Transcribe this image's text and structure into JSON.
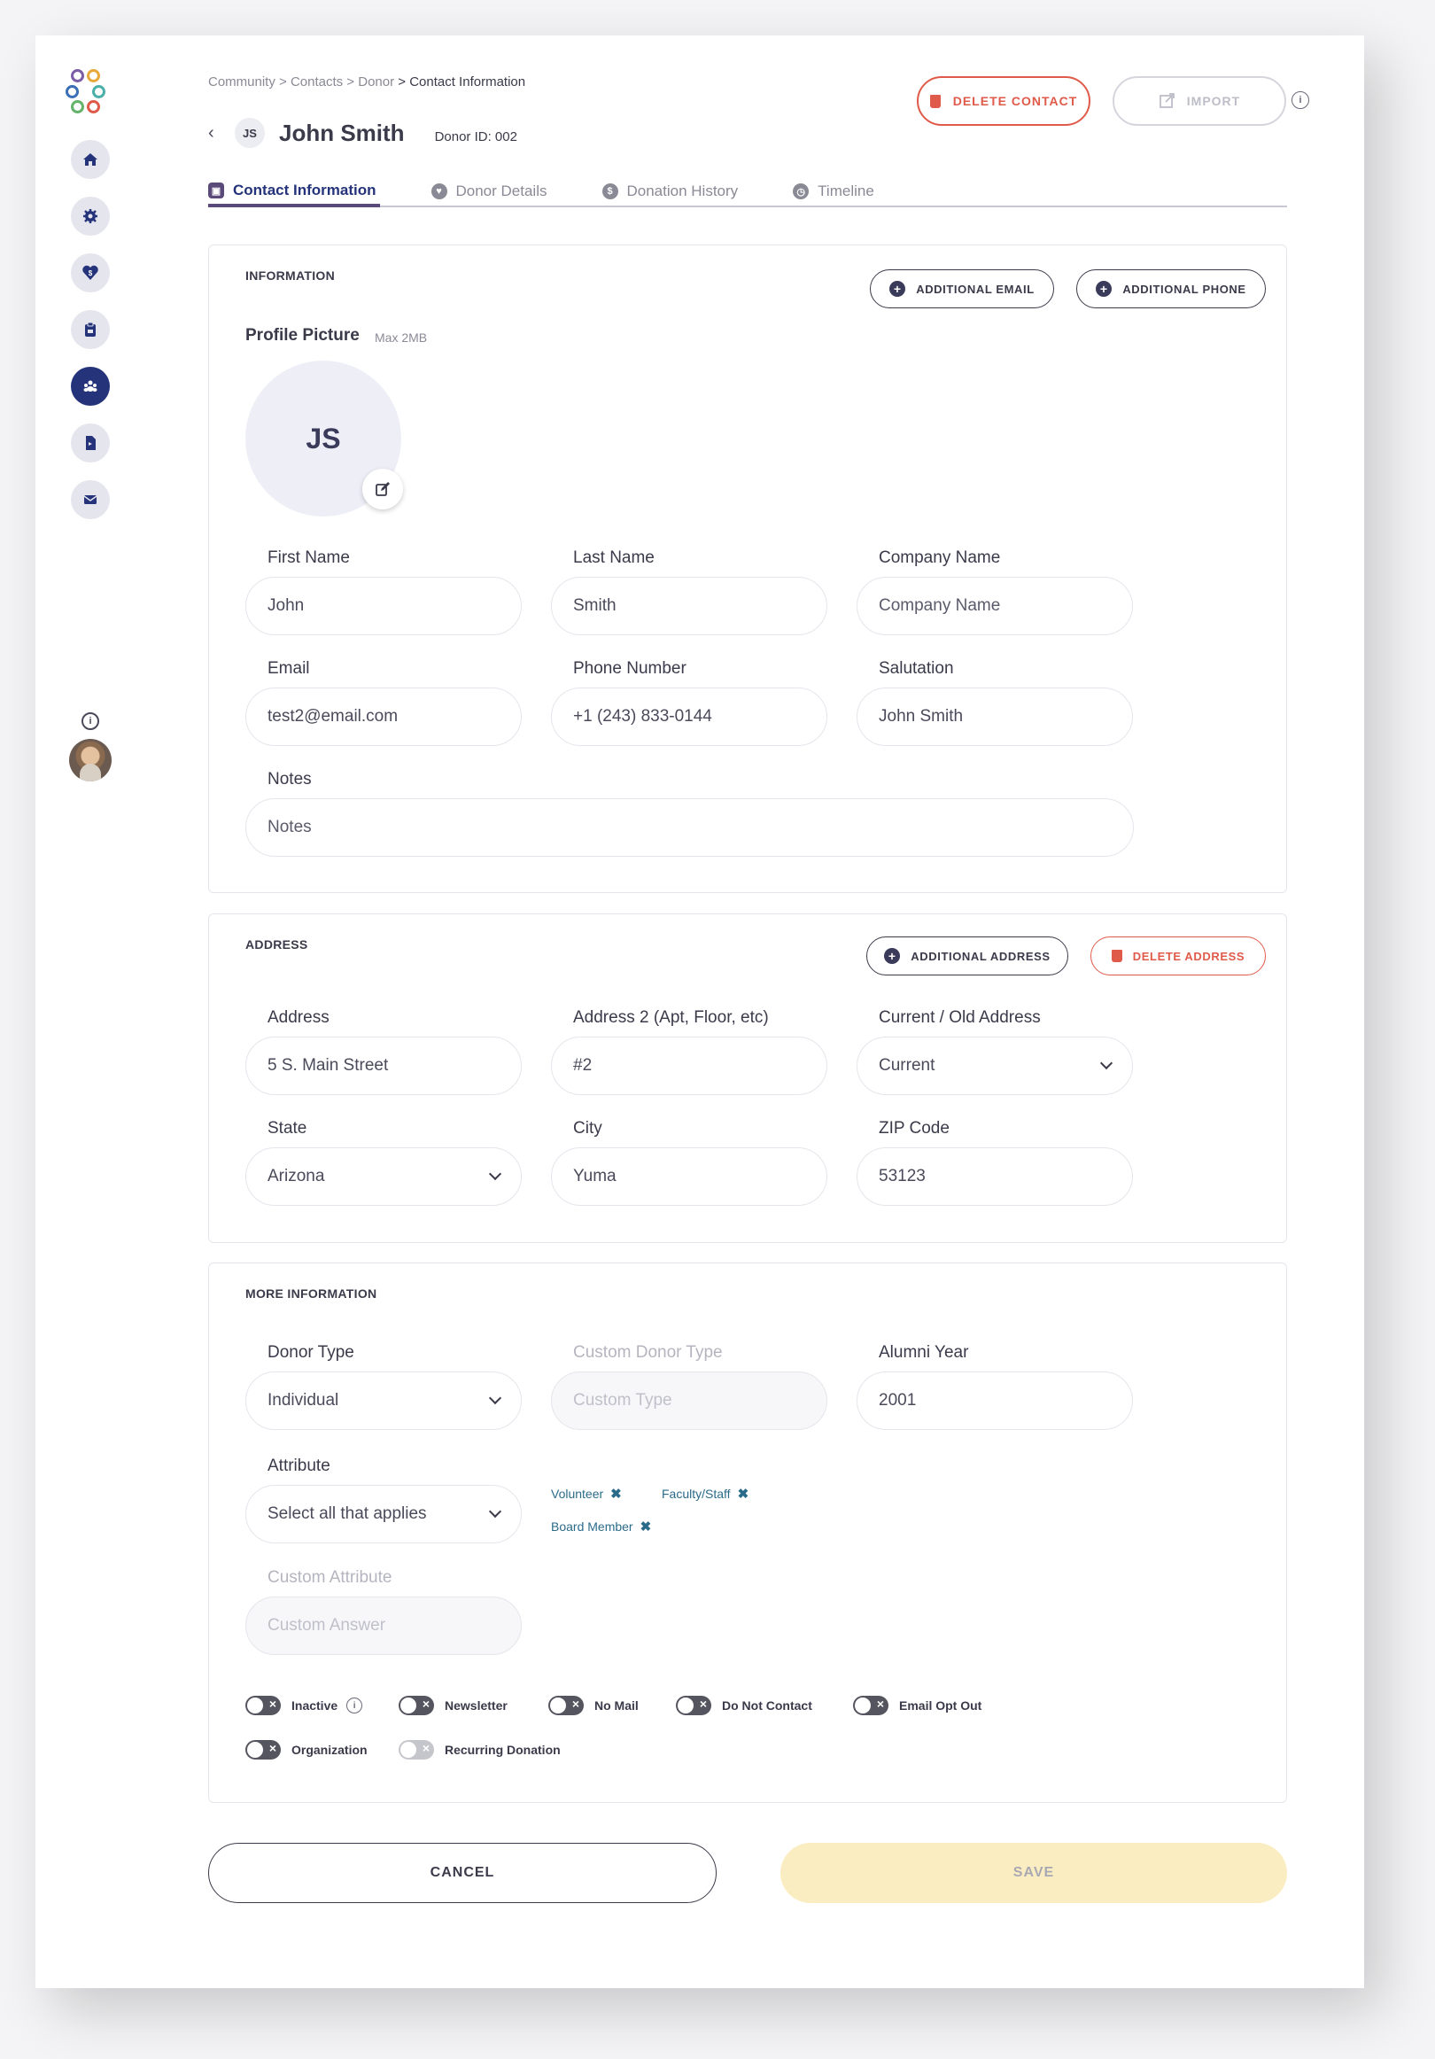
{
  "breadcrumb": {
    "part1": "Community > Contacts > Donor",
    "current": "> Contact Information"
  },
  "header": {
    "initials": "JS",
    "name": "John Smith",
    "donor_id": "Donor ID: 002",
    "back_icon": "chevron-left-icon"
  },
  "actions": {
    "delete_contact": "DELETE CONTACT",
    "import": "IMPORT"
  },
  "tabs": [
    {
      "label": "Contact Information",
      "active": true
    },
    {
      "label": "Donor Details",
      "active": false
    },
    {
      "label": "Donation History",
      "active": false
    },
    {
      "label": "Timeline",
      "active": false
    }
  ],
  "sidebar": {
    "items": [
      "home-icon",
      "settings-icon",
      "donation-icon",
      "clipboard-icon",
      "community-icon",
      "document-icon",
      "mail-icon"
    ],
    "active_item": "community-icon"
  },
  "information": {
    "title": "INFORMATION",
    "additional_email": "ADDITIONAL EMAIL",
    "additional_phone": "ADDITIONAL PHONE",
    "profile_label": "Profile Picture",
    "profile_note": "Max 2MB",
    "profile_initials": "JS",
    "first_name_label": "First Name",
    "first_name": "John",
    "last_name_label": "Last Name",
    "last_name": "Smith",
    "company_label": "Company Name",
    "company_placeholder": "Company Name",
    "email_label": "Email",
    "email": "test2@email.com",
    "phone_label": "Phone Number",
    "phone": "+1 (243) 833-0144",
    "salutation_label": "Salutation",
    "salutation": "John Smith",
    "notes_label": "Notes",
    "notes_placeholder": "Notes"
  },
  "address": {
    "title": "ADDRESS",
    "additional_address": "ADDITIONAL ADDRESS",
    "delete_address": "DELETE ADDRESS",
    "address_label": "Address",
    "address": "5 S. Main Street",
    "address2_label": "Address 2 (Apt, Floor, etc)",
    "address2": "#2",
    "current_old_label": "Current / Old Address",
    "current_old": "Current",
    "state_label": "State",
    "state": "Arizona",
    "city_label": "City",
    "city": "Yuma",
    "zip_label": "ZIP Code",
    "zip": "53123"
  },
  "more_info": {
    "title": "MORE INFORMATION",
    "donor_type_label": "Donor Type",
    "donor_type": "Individual",
    "custom_donor_type_label": "Custom Donor Type",
    "custom_donor_type_placeholder": "Custom Type",
    "alumni_year_label": "Alumni Year",
    "alumni_year": "2001",
    "attribute_label": "Attribute",
    "attribute_placeholder": "Select all that applies",
    "chips": [
      "Volunteer",
      "Faculty/Staff",
      "Board Member"
    ],
    "custom_attribute_label": "Custom Attribute",
    "custom_attribute_placeholder": "Custom Answer",
    "toggles": [
      {
        "label": "Inactive",
        "on": false
      },
      {
        "label": "Newsletter",
        "on": false
      },
      {
        "label": "No Mail",
        "on": false
      },
      {
        "label": "Do Not Contact",
        "on": false
      },
      {
        "label": "Email Opt Out",
        "on": false
      },
      {
        "label": "Organization",
        "on": false
      },
      {
        "label": "Recurring Donation",
        "on": false,
        "disabled": true
      }
    ]
  },
  "footer": {
    "cancel": "CANCEL",
    "save": "SAVE"
  },
  "colors": {
    "primary": "#24337a",
    "danger": "#e05a4a",
    "save_bg": "#fbedc2",
    "chip": "#2b6b8a"
  }
}
